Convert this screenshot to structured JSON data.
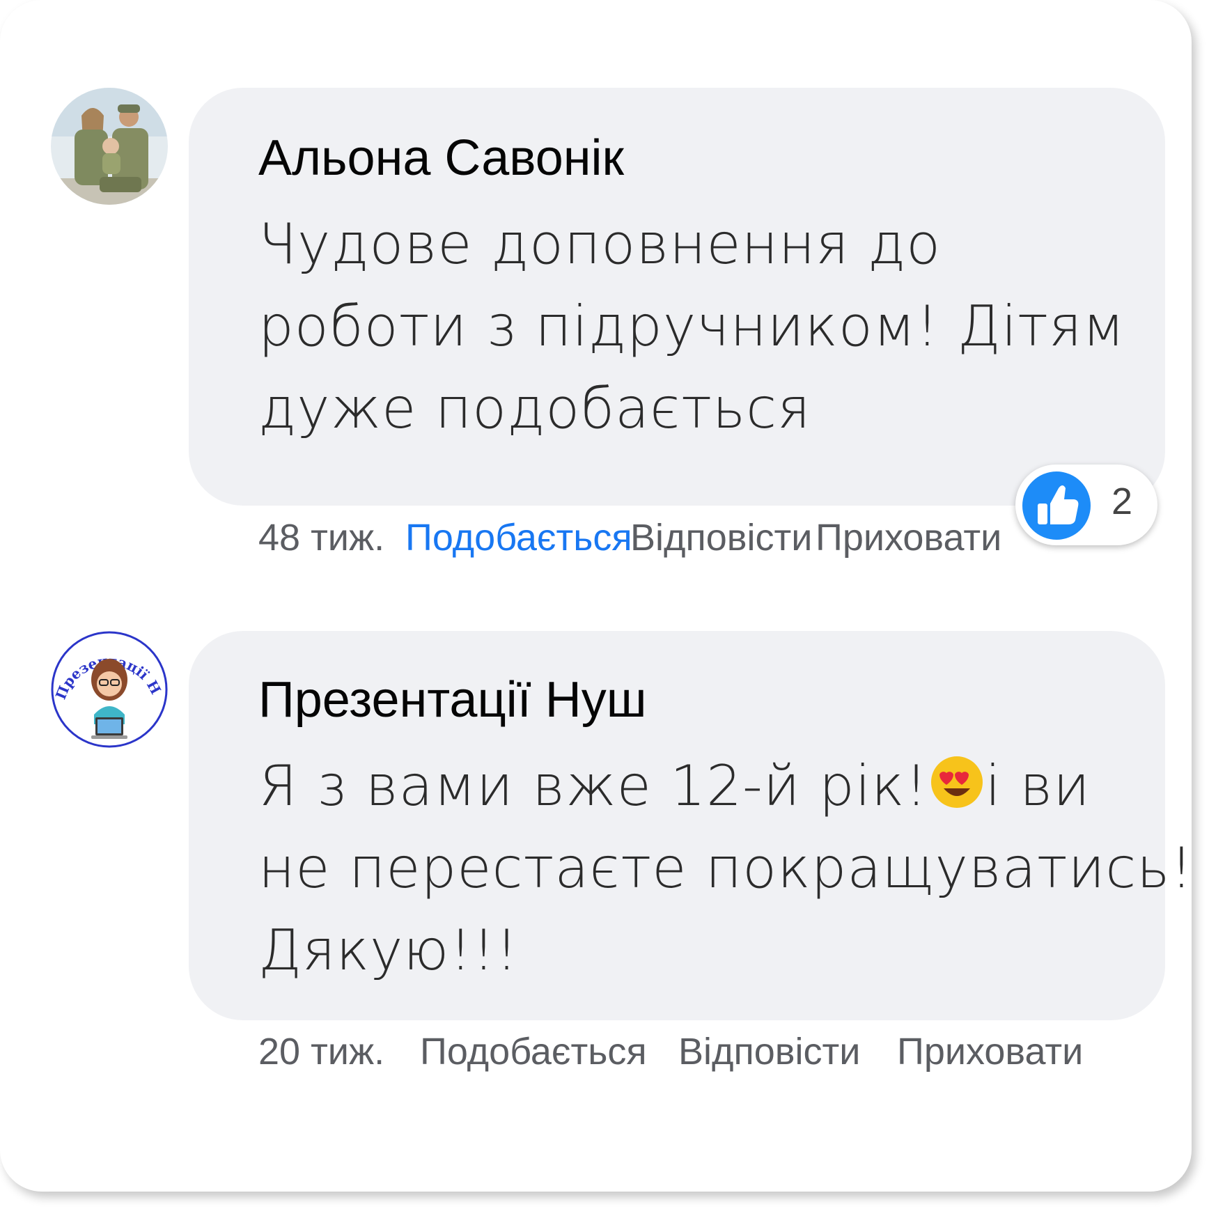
{
  "comments": [
    {
      "author": "Альона Савонік",
      "text_lines": [
        "Чудове доповнення до",
        "роботи з підручником! Дітям",
        "дуже подобається"
      ],
      "time": "48 тиж.",
      "like_label": "Подобається",
      "reply_label": "Відповісти",
      "hide_label": "Приховати",
      "liked": true,
      "reactions": {
        "icon": "thumbs-up-icon",
        "count": "2"
      }
    },
    {
      "author": "Презентації Нуш",
      "text_lines": [
        "Я з вами вже 12-й рік!",
        "і ви",
        "не перестаєте покращуватись!",
        "Дякую!!!"
      ],
      "emoji": "heart-eyes-emoji-icon",
      "time": "20 тиж.",
      "like_label": "Подобається",
      "reply_label": "Відповісти",
      "hide_label": "Приховати",
      "liked": false
    }
  ],
  "colors": {
    "bubble": "#f0f1f4",
    "liked_accent": "#1877f2",
    "meta_text": "#5b5d62"
  },
  "avatar_texts": {
    "second": "Презентації НУШ"
  }
}
